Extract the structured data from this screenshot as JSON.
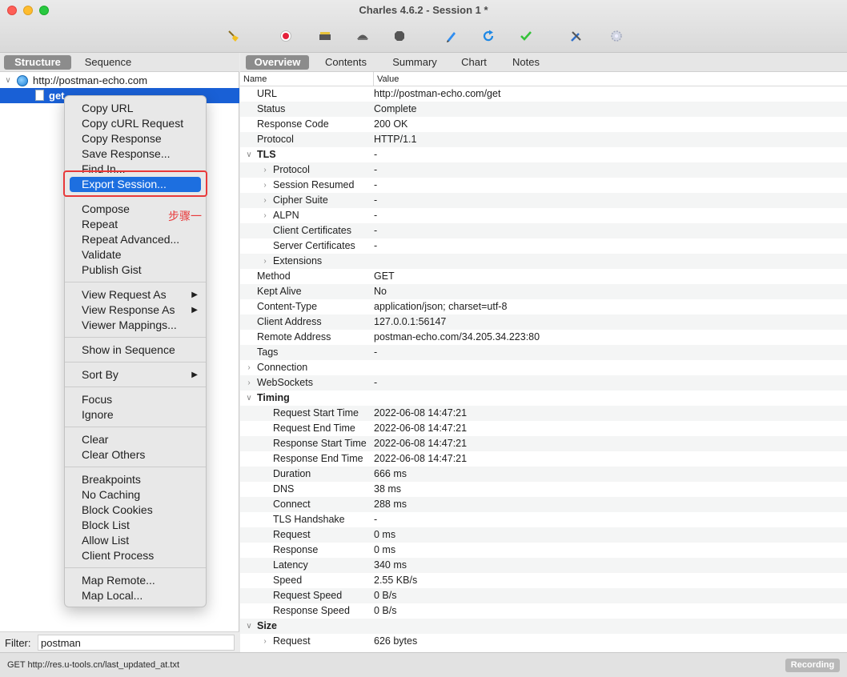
{
  "window": {
    "title": "Charles 4.6.2 - Session 1 *"
  },
  "toolbar": {
    "icons": [
      "broom-icon",
      "record-icon",
      "throttle-icon",
      "turtle-icon",
      "stop-icon",
      "compose-pen-icon",
      "repeat-icon",
      "validate-check-icon",
      "tools-icon",
      "settings-gear-icon"
    ]
  },
  "left": {
    "tabs": [
      "Structure",
      "Sequence"
    ],
    "tree": {
      "host": "http://postman-echo.com",
      "child": "get"
    },
    "filter": {
      "label": "Filter:",
      "value": "postman"
    }
  },
  "right": {
    "tabs": [
      "Overview",
      "Contents",
      "Summary",
      "Chart",
      "Notes"
    ],
    "columns": {
      "name": "Name",
      "value": "Value"
    },
    "rows": [
      {
        "name": "URL",
        "value": "http://postman-echo.com/get",
        "level": 1
      },
      {
        "name": "Status",
        "value": "Complete",
        "level": 1
      },
      {
        "name": "Response Code",
        "value": "200 OK",
        "level": 1
      },
      {
        "name": "Protocol",
        "value": "HTTP/1.1",
        "level": 1
      },
      {
        "name": "TLS",
        "value": "-",
        "level": 0,
        "toggle": "open",
        "bold": true
      },
      {
        "name": "Protocol",
        "value": "-",
        "level": 2,
        "toggle": "closed"
      },
      {
        "name": "Session Resumed",
        "value": "-",
        "level": 2,
        "toggle": "closed"
      },
      {
        "name": "Cipher Suite",
        "value": "-",
        "level": 2,
        "toggle": "closed"
      },
      {
        "name": "ALPN",
        "value": "-",
        "level": 2,
        "toggle": "closed"
      },
      {
        "name": "Client Certificates",
        "value": "-",
        "level": 2
      },
      {
        "name": "Server Certificates",
        "value": "-",
        "level": 2
      },
      {
        "name": "Extensions",
        "value": "",
        "level": 2,
        "toggle": "closed"
      },
      {
        "name": "Method",
        "value": "GET",
        "level": 1
      },
      {
        "name": "Kept Alive",
        "value": "No",
        "level": 1
      },
      {
        "name": "Content-Type",
        "value": "application/json; charset=utf-8",
        "level": 1
      },
      {
        "name": "Client Address",
        "value": "127.0.0.1:56147",
        "level": 1
      },
      {
        "name": "Remote Address",
        "value": "postman-echo.com/34.205.34.223:80",
        "level": 1
      },
      {
        "name": "Tags",
        "value": "-",
        "level": 1
      },
      {
        "name": "Connection",
        "value": "",
        "level": 0,
        "toggle": "closed"
      },
      {
        "name": "WebSockets",
        "value": "-",
        "level": 0,
        "toggle": "closed"
      },
      {
        "name": "Timing",
        "value": "",
        "level": 0,
        "toggle": "open",
        "bold": true
      },
      {
        "name": "Request Start Time",
        "value": "2022-06-08 14:47:21",
        "level": 2
      },
      {
        "name": "Request End Time",
        "value": "2022-06-08 14:47:21",
        "level": 2
      },
      {
        "name": "Response Start Time",
        "value": "2022-06-08 14:47:21",
        "level": 2
      },
      {
        "name": "Response End Time",
        "value": "2022-06-08 14:47:21",
        "level": 2
      },
      {
        "name": "Duration",
        "value": "666 ms",
        "level": 2
      },
      {
        "name": "DNS",
        "value": "38 ms",
        "level": 2
      },
      {
        "name": "Connect",
        "value": "288 ms",
        "level": 2
      },
      {
        "name": "TLS Handshake",
        "value": "-",
        "level": 2
      },
      {
        "name": "Request",
        "value": "0 ms",
        "level": 2
      },
      {
        "name": "Response",
        "value": "0 ms",
        "level": 2
      },
      {
        "name": "Latency",
        "value": "340 ms",
        "level": 2
      },
      {
        "name": "Speed",
        "value": "2.55 KB/s",
        "level": 2
      },
      {
        "name": "Request Speed",
        "value": "0 B/s",
        "level": 2
      },
      {
        "name": "Response Speed",
        "value": "0 B/s",
        "level": 2
      },
      {
        "name": "Size",
        "value": "",
        "level": 0,
        "toggle": "open",
        "bold": true
      },
      {
        "name": "Request",
        "value": "626 bytes",
        "level": 2,
        "toggle": "closed"
      }
    ]
  },
  "context_menu": {
    "groups": [
      [
        {
          "label": "Copy URL"
        },
        {
          "label": "Copy cURL Request"
        },
        {
          "label": "Copy Response"
        },
        {
          "label": "Save Response..."
        },
        {
          "label": "Find In..."
        },
        {
          "label": "Export Session...",
          "highlighted": true
        }
      ],
      [
        {
          "label": "Compose"
        },
        {
          "label": "Repeat"
        },
        {
          "label": "Repeat Advanced..."
        },
        {
          "label": "Validate"
        },
        {
          "label": "Publish Gist"
        }
      ],
      [
        {
          "label": "View Request As",
          "submenu": true
        },
        {
          "label": "View Response As",
          "submenu": true
        },
        {
          "label": "Viewer Mappings..."
        }
      ],
      [
        {
          "label": "Show in Sequence"
        }
      ],
      [
        {
          "label": "Sort By",
          "submenu": true
        }
      ],
      [
        {
          "label": "Focus"
        },
        {
          "label": "Ignore"
        }
      ],
      [
        {
          "label": "Clear"
        },
        {
          "label": "Clear Others"
        }
      ],
      [
        {
          "label": "Breakpoints"
        },
        {
          "label": "No Caching"
        },
        {
          "label": "Block Cookies"
        },
        {
          "label": "Block List"
        },
        {
          "label": "Allow List"
        },
        {
          "label": "Client Process"
        }
      ],
      [
        {
          "label": "Map Remote..."
        },
        {
          "label": "Map Local..."
        }
      ]
    ]
  },
  "annotation": {
    "text": "步骤一",
    "color": "#e8393a"
  },
  "statusbar": {
    "text": "GET http://res.u-tools.cn/last_updated_at.txt",
    "recording_label": "Recording"
  },
  "colors": {
    "selection": "#1960d6",
    "menu_highlight": "#1d6fe0"
  }
}
